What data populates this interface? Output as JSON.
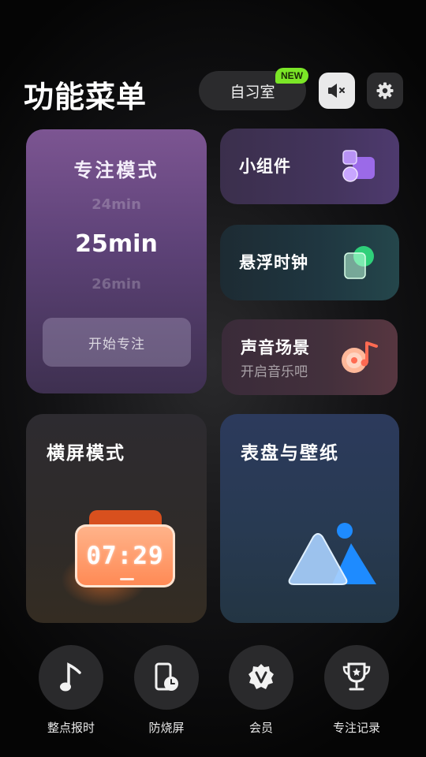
{
  "header": {
    "title": "功能菜单",
    "study_room": "自习室",
    "new_badge": "NEW",
    "mute_icon": "speaker-muted-icon",
    "settings_icon": "gear-icon"
  },
  "focus_card": {
    "title": "专注模式",
    "time_prev": "24min",
    "time_current": "25min",
    "time_next": "26min",
    "start_label": "开始专注"
  },
  "widget_card": {
    "title": "小组件",
    "icon": "widget-shapes-icon"
  },
  "clock_card": {
    "title": "悬浮时钟",
    "icon": "floating-window-icon"
  },
  "sound_card": {
    "title": "声音场景",
    "subtitle": "开启音乐吧",
    "icon": "music-record-icon"
  },
  "landscape_card": {
    "title": "横屏模式",
    "clock_time": "07:29"
  },
  "dial_card": {
    "title": "表盘与壁纸",
    "icon": "mountain-picture-icon"
  },
  "bottom_nav": [
    {
      "label": "整点报时",
      "icon": "music-note-icon"
    },
    {
      "label": "防烧屏",
      "icon": "phone-clock-icon"
    },
    {
      "label": "会员",
      "icon": "vip-badge-icon"
    },
    {
      "label": "专注记录",
      "icon": "trophy-icon"
    }
  ],
  "colors": {
    "new_badge": "#7be627",
    "focus_card": "#7c5592",
    "landscape_clock": "#ff8a55",
    "dial_icon": "#1e8bff"
  }
}
